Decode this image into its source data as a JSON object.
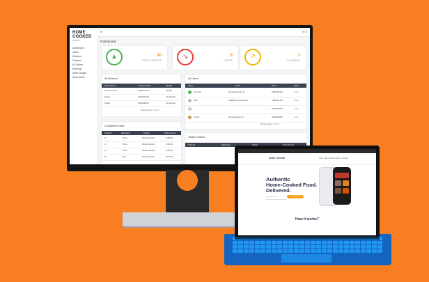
{
  "dashboard": {
    "logo": "HOME COOKED",
    "logo_sub": "ADMIN",
    "sidebar_items": [
      "Dashboard",
      "Users",
      "Kitchens",
      "Cuisines",
      "All Orders",
      "Earnings",
      "Store Images",
      "Store Items"
    ],
    "page_title": "Dashboard",
    "stats": [
      {
        "value": "40",
        "label": "TOTAL ORDERS",
        "color": "#4CAF50"
      },
      {
        "value": "6",
        "label": "USERS",
        "color": "#E53935"
      },
      {
        "value": "3",
        "label": "KITCHENS",
        "color": "#F5B400"
      }
    ],
    "kitchens": {
      "title": "All Kitchens",
      "headers": [
        "Kitchen Name",
        "Contact Number",
        "Payable"
      ],
      "rows": [
        [
          "Kitchen Karachi",
          "03001307100",
          "Payable"
        ],
        [
          "Paraza",
          "03001307105",
          "Not Payable"
        ],
        [
          "Pastas",
          "03012345678",
          "Not Payable"
        ]
      ],
      "pager": "Rows per page:",
      "range": "1-3 of 3"
    },
    "users": {
      "title": "All Users",
      "headers": [
        "Name",
        "Email",
        "Phone",
        "Status"
      ],
      "rows": [
        {
          "name": "John Doe",
          "email": "johndoe@gmail.com",
          "phone": "03001307100",
          "status": "active"
        },
        {
          "name": "Sara",
          "email": "sara@homecooked.com",
          "phone": "03001307105",
          "status": "active"
        },
        {
          "name": "-",
          "email": "-",
          "phone": "03012345678",
          "status": "active"
        },
        {
          "name": "Ahmed",
          "email": "ahmed@gmail.com",
          "phone": "03012345690",
          "status": "active"
        }
      ],
      "pager": "Rows per page:",
      "range": "1-4 of 4"
    },
    "completed": {
      "title": "Completed orders",
      "headers": [
        "Order ID",
        "Dish Name",
        "Kitchen",
        "Order Amount"
      ],
      "rows": [
        [
          "11",
          "Pizza",
          "Kitchen Karachi",
          "$ 450.00"
        ],
        [
          "12",
          "Pizza",
          "Kitchen Karachi",
          "$ 451.00"
        ],
        [
          "14",
          "Pizza",
          "Kitchen Karachi",
          "$ 451.00"
        ],
        [
          "15",
          "Roll",
          "Kitchen Karachi",
          "$ 120.00"
        ]
      ]
    },
    "todays": {
      "title": "Today's Orders",
      "headers": [
        "Order ID",
        "Dish Name",
        "Kitchen",
        "Order Amount"
      ]
    }
  },
  "website": {
    "logo": "HOME COOKED",
    "nav_links": [
      "Home",
      "How it works",
      "Kitchens",
      "Contact"
    ],
    "hero_line1": "Authentic",
    "hero_line2": "Home-Cooked Food.",
    "hero_line3": "Delivered.",
    "email_placeholder": "Enter your email",
    "cta_label": "Get Started",
    "how_title": "How it works?"
  },
  "colors": {
    "background": "#F77F22",
    "table_header": "#3a4150",
    "keyboard": "#1565C0",
    "cta": "#F7A21B"
  }
}
